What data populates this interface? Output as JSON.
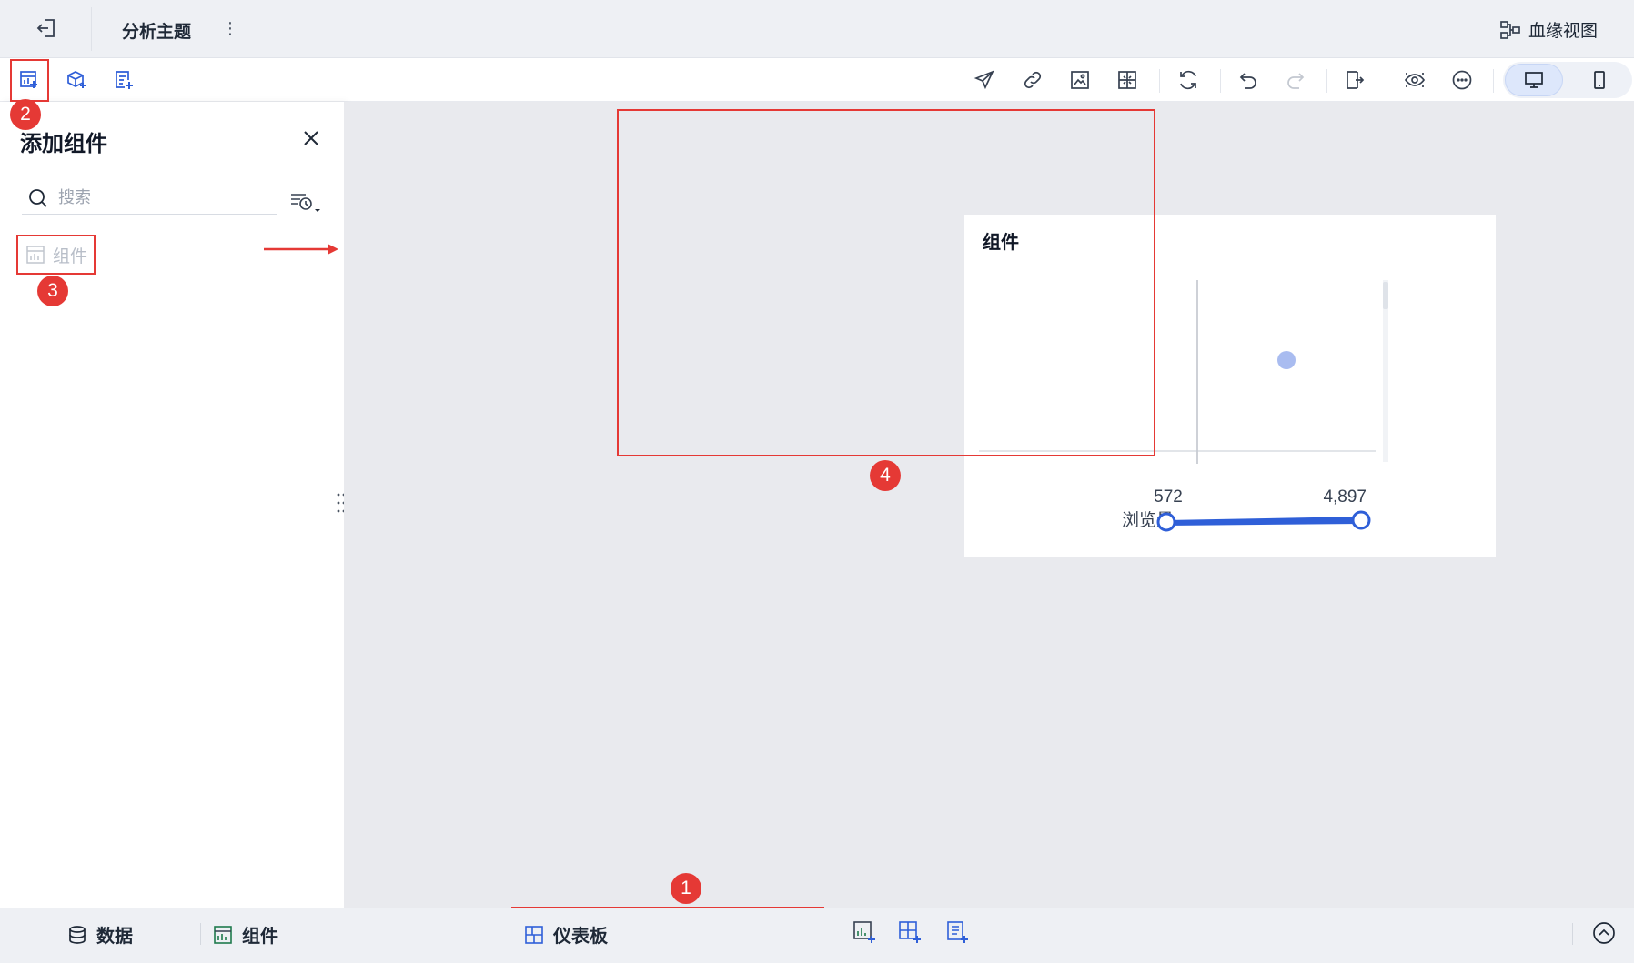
{
  "header": {
    "title": "分析主题",
    "lineage_label": "血缘视图"
  },
  "panel": {
    "title": "添加组件",
    "search_placeholder": "搜索",
    "items": [
      {
        "label": "组件"
      }
    ]
  },
  "widget": {
    "title": "组件",
    "slider": {
      "label": "浏览量",
      "min_label": "572",
      "max_label": "4,897"
    }
  },
  "bottom": {
    "tabs": [
      {
        "label": "数据"
      },
      {
        "label": "组件"
      },
      {
        "label": "仪表板"
      }
    ]
  },
  "annotations": [
    "1",
    "2",
    "3",
    "4"
  ],
  "colors": {
    "accent": "#2f5fd8",
    "highlight": "#e53935",
    "point": "#a9bcf0"
  }
}
